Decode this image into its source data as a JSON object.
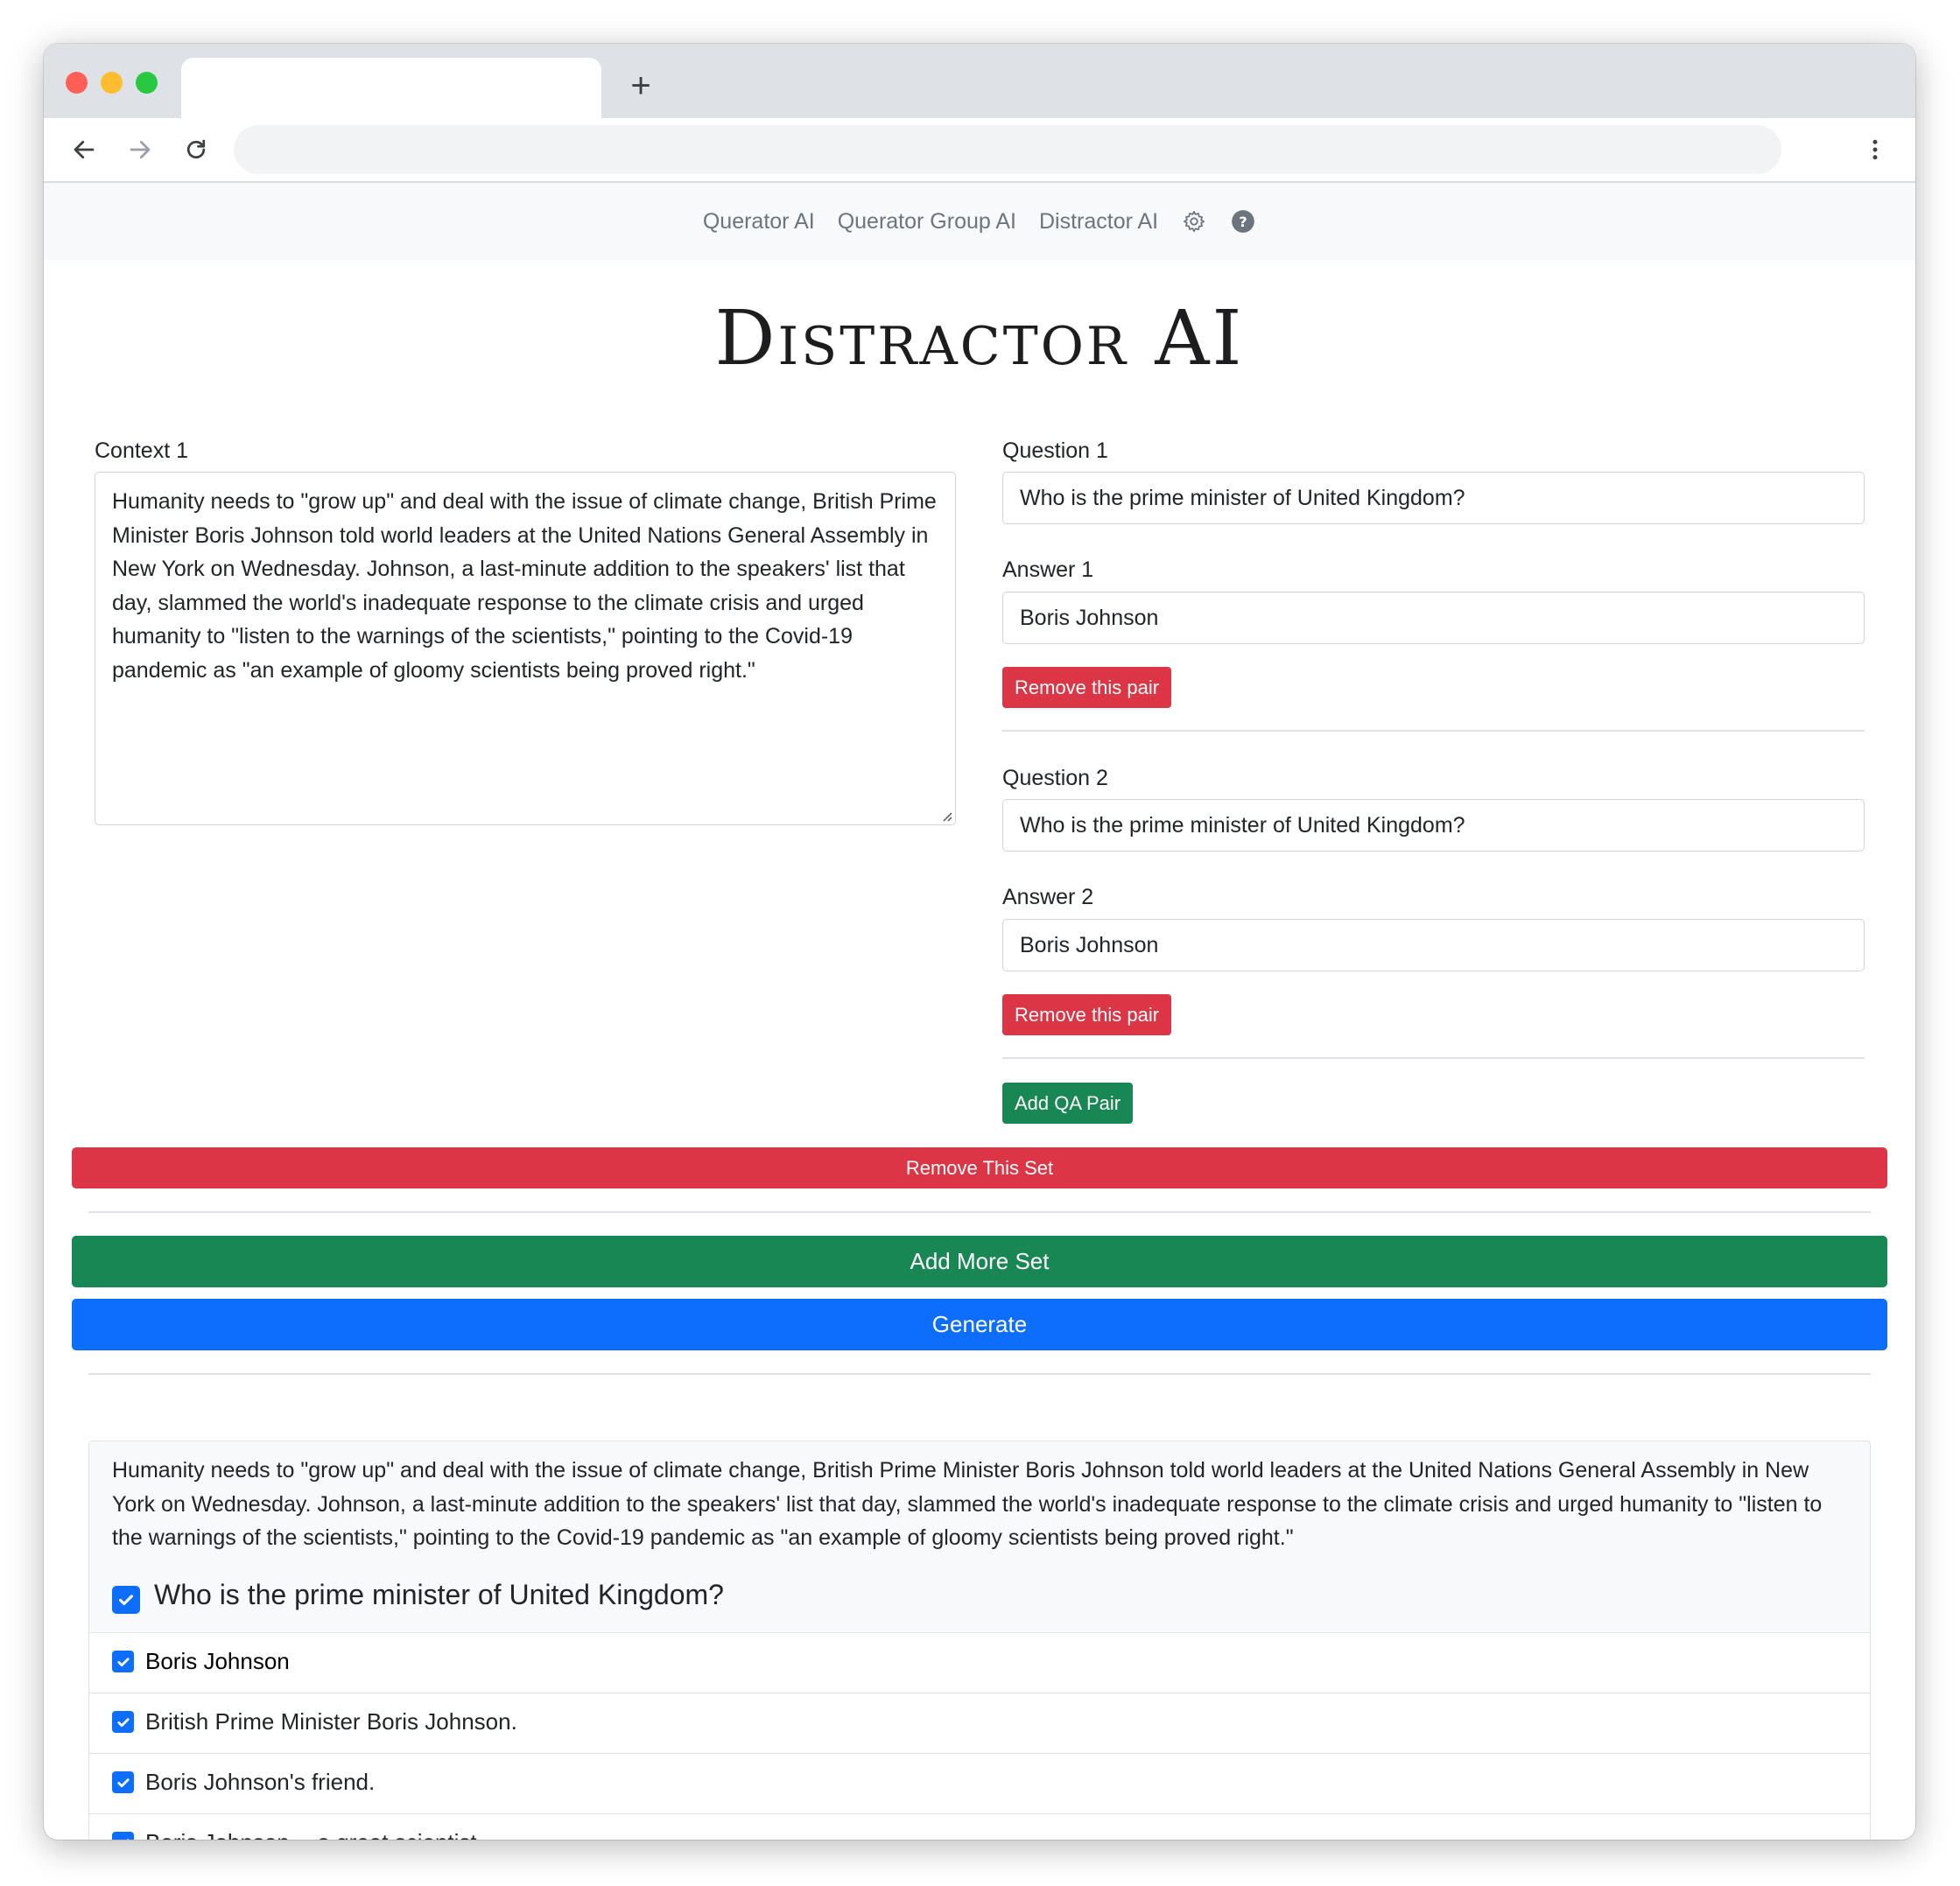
{
  "nav": {
    "links": [
      "Querator AI",
      "Querator Group AI",
      "Distractor AI"
    ],
    "settings_icon": "gear-icon",
    "help_icon": "question-circle-icon"
  },
  "page": {
    "title": "Distractor AI"
  },
  "context_set": {
    "context_label": "Context 1",
    "context_text": "Humanity needs to \"grow up\" and deal with the issue of climate change, British Prime Minister Boris Johnson told world leaders at the United Nations General Assembly in New York on Wednesday. Johnson, a last-minute addition to the speakers' list that day, slammed the world's inadequate response to the climate crisis and urged humanity to \"listen to the warnings of the scientists,\" pointing to the Covid-19 pandemic as \"an example of gloomy scientists being proved right.\"",
    "pairs": [
      {
        "question_label": "Question 1",
        "question": "Who is the prime minister of United Kingdom?",
        "answer_label": "Answer 1",
        "answer": "Boris Johnson",
        "remove_label": "Remove this pair"
      },
      {
        "question_label": "Question 2",
        "question": "Who is the prime minister of United Kingdom?",
        "answer_label": "Answer 2",
        "answer": "Boris Johnson",
        "remove_label": "Remove this pair"
      }
    ],
    "add_pair_label": "Add QA Pair",
    "remove_set_label": "Remove This Set"
  },
  "actions": {
    "add_more_set": "Add More Set",
    "generate": "Generate"
  },
  "result": {
    "context_text": "Humanity needs to \"grow up\" and deal with the issue of climate change, British Prime Minister Boris Johnson told world leaders at the United Nations General Assembly in New York on Wednesday. Johnson, a last-minute addition to the speakers' list that day, slammed the world's inadequate response to the climate crisis and urged humanity to \"listen to the warnings of the scientists,\" pointing to the Covid-19 pandemic as \"an example of gloomy scientists being proved right.\"",
    "question": "Who is the prime minister of United Kingdom?",
    "answers": [
      "Boris Johnson",
      "British Prime Minister Boris Johnson.",
      "Boris Johnson's friend.",
      "Boris Johnson -- a great scientist"
    ]
  },
  "colors": {
    "danger": "#dc3545",
    "success": "#198754",
    "primary": "#0d6efd"
  }
}
